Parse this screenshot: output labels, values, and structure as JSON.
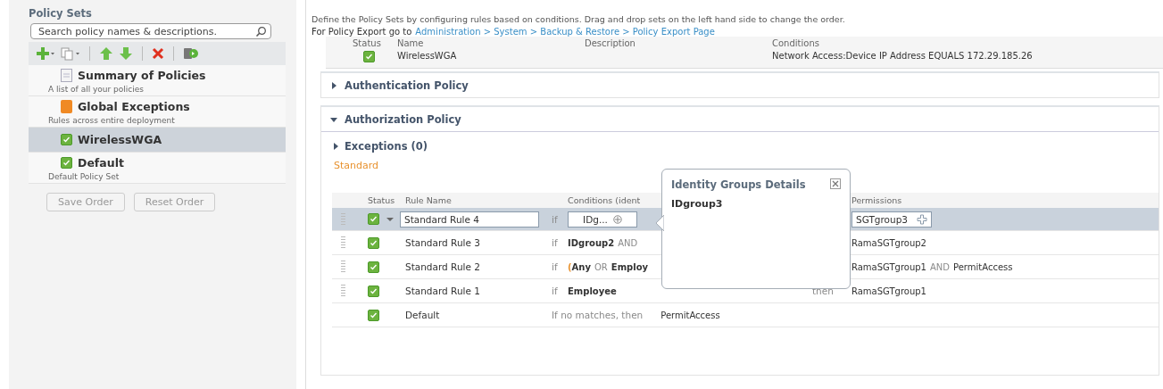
{
  "sidebar": {
    "title": "Policy Sets",
    "search": {
      "placeholder": "Search policy names & descriptions."
    },
    "items": [
      {
        "name": "Summary of Policies",
        "description": "A list of all your policies",
        "kind": "summary",
        "selected": false
      },
      {
        "name": "Global Exceptions",
        "description": "Rules across entire deployment",
        "kind": "exceptions",
        "selected": false
      },
      {
        "name": "WirelessWGA",
        "kind": "policy_set",
        "enabled": true,
        "selected": true
      },
      {
        "name": "Default",
        "description": "Default Policy Set",
        "kind": "policy_set",
        "enabled": true,
        "selected": false
      }
    ],
    "buttons": [
      {
        "label": "Save Order",
        "disabled": true
      },
      {
        "label": "Reset Order",
        "disabled": true
      }
    ]
  },
  "main": {
    "intro": "Define the Policy Sets by configuring rules based on conditions. Drag and drop sets on the left hand side to change the order.",
    "export_label": "For Policy Export go to",
    "export_link": "Administration > System > Backup & Restore > Policy Export Page",
    "policy_set": {
      "columns": [
        "Status",
        "Name",
        "Description",
        "Conditions"
      ],
      "enabled": true,
      "name": "WirelessWGA",
      "conditions": "Network Access:Device IP Address EQUALS 172.29.185.26"
    },
    "sections": [
      {
        "title": "Authentication Policy",
        "expanded": false
      },
      {
        "title": "Authorization Policy",
        "expanded": true
      }
    ],
    "exceptions": {
      "label": "Exceptions (0)",
      "expanded": false
    },
    "standard_label": "Standard",
    "rules": {
      "columns": [
        "Status",
        "Rule Name",
        "Conditions (ident",
        "Permissions"
      ],
      "rows": [
        {
          "kind": "editing",
          "enabled": true,
          "name": "Standard Rule 4",
          "if": "if",
          "condition": "IDg...",
          "permission": "SGTgroup3"
        },
        {
          "kind": "rule",
          "enabled": true,
          "name": "Standard Rule 3",
          "if": "if",
          "condition": [
            {
              "text": "IDgroup2",
              "kind": "group"
            },
            {
              "text": "AND",
              "kind": "operator"
            }
          ],
          "permission": [
            {
              "text": "RamaSGTgroup2",
              "kind": "group"
            }
          ]
        },
        {
          "kind": "rule",
          "enabled": true,
          "name": "Standard Rule 2",
          "if": "if",
          "condition": [
            {
              "text": "(",
              "kind": "paren"
            },
            {
              "text": "Any",
              "kind": "group"
            },
            {
              "text": "OR",
              "kind": "operator"
            },
            {
              "text": "Employ",
              "kind": "group"
            }
          ],
          "permission": [
            {
              "text": "RamaSGTgroup1",
              "kind": "group"
            },
            {
              "text": "AND",
              "kind": "operator"
            },
            {
              "text": "PermitAccess",
              "kind": "group"
            }
          ]
        },
        {
          "kind": "rule",
          "enabled": true,
          "name": "Standard Rule 1",
          "if": "if",
          "condition": [
            {
              "text": "Employee",
              "kind": "group"
            }
          ],
          "then": "then",
          "permission": [
            {
              "text": "RamaSGTgroup1",
              "kind": "group"
            }
          ]
        },
        {
          "kind": "default",
          "enabled": true,
          "name": "Default",
          "fallback": "If no matches, then",
          "permission": [
            {
              "text": "PermitAccess",
              "kind": "group"
            }
          ]
        }
      ]
    },
    "popover": {
      "title": "Identity Groups Details",
      "items": [
        "IDgroup3"
      ]
    }
  }
}
